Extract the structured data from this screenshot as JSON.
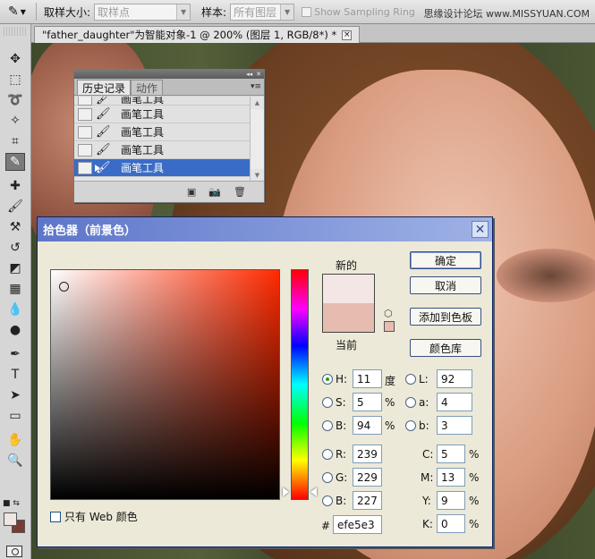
{
  "options_bar": {
    "sample_size_label": "取样大小:",
    "sample_size_value": "取样点",
    "sample_label": "样本:",
    "sample_value": "所有图层",
    "show_ring_label": "Show Sampling Ring",
    "watermark": "思缘设计论坛 www.MISSYUAN.COM"
  },
  "document": {
    "tab_title": "\"father_daughter\"为智能对象-1 @ 200% (图层 1, RGB/8*) *",
    "close_glyph": "×"
  },
  "history_panel": {
    "tab_history": "历史记录",
    "tab_actions": "动作",
    "items": [
      {
        "label": "画笔工具"
      },
      {
        "label": "画笔工具"
      },
      {
        "label": "画笔工具"
      },
      {
        "label": "画笔工具"
      },
      {
        "label": "画笔工具",
        "selected": true
      }
    ]
  },
  "color_picker": {
    "title": "拾色器（前景色）",
    "new_label": "新的",
    "current_label": "当前",
    "new_color": "#f4e6e4",
    "current_color": "#e6bcb1",
    "buttons": {
      "ok": "确定",
      "cancel": "取消",
      "add_to_swatches": "添加到色板",
      "color_libraries": "颜色库"
    },
    "hsb": {
      "h_label": "H:",
      "h_value": "11",
      "h_unit": "度",
      "s_label": "S:",
      "s_value": "5",
      "s_unit": "%",
      "b_label": "B:",
      "b_value": "94",
      "b_unit": "%"
    },
    "lab": {
      "l_label": "L:",
      "l_value": "92",
      "a_label": "a:",
      "a_value": "4",
      "b_label": "b:",
      "b_value": "3"
    },
    "rgb": {
      "r_label": "R:",
      "r_value": "239",
      "g_label": "G:",
      "g_value": "229",
      "b_label": "B:",
      "b_value": "227"
    },
    "cmyk": {
      "c_label": "C:",
      "c_value": "5",
      "m_label": "M:",
      "m_value": "13",
      "y_label": "Y:",
      "y_value": "9",
      "k_label": "K:",
      "k_value": "0",
      "unit": "%"
    },
    "hex_label": "#",
    "hex_value": "efe5e3",
    "web_only_label": "只有 Web 颜色",
    "selected_mode": "H"
  },
  "colors": {
    "foreground": "#efe5e3",
    "background": "#7a3a34",
    "selection_blue": "#3a6bc6",
    "dialog_title": "#5d75c9"
  }
}
